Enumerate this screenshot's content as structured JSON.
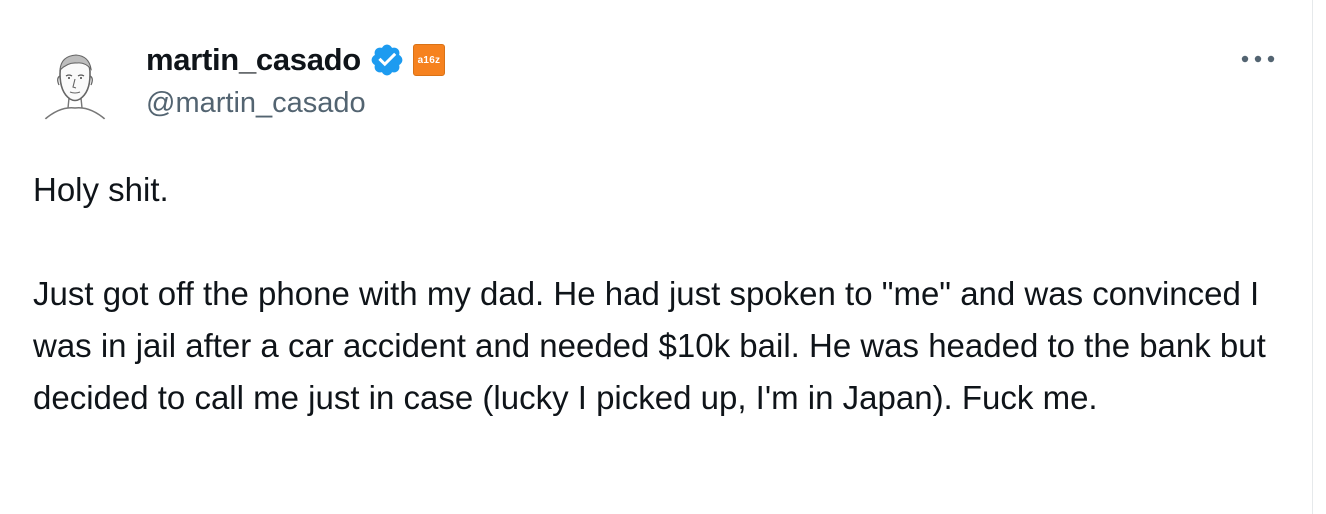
{
  "tweet": {
    "author": {
      "display_name": "martin_casado",
      "handle": "@martin_casado",
      "verified_icon": "verified-badge-icon",
      "affiliation_badge_text": "a16z",
      "avatar_icon": "sketch-portrait-avatar"
    },
    "more_icon": "more-options-icon",
    "text": "Holy shit.\n\nJust got off the phone with my dad. He had just spoken to \"me\" and was convinced I was in jail after a car accident and needed $10k bail. He was headed to the bank but decided to call me just in case (lucky I picked up, I'm in Japan). Fuck me."
  },
  "colors": {
    "verified_blue": "#1d9bf0",
    "badge_orange": "#f6821f",
    "secondary_text": "#536471",
    "primary_text": "#0f1419"
  }
}
